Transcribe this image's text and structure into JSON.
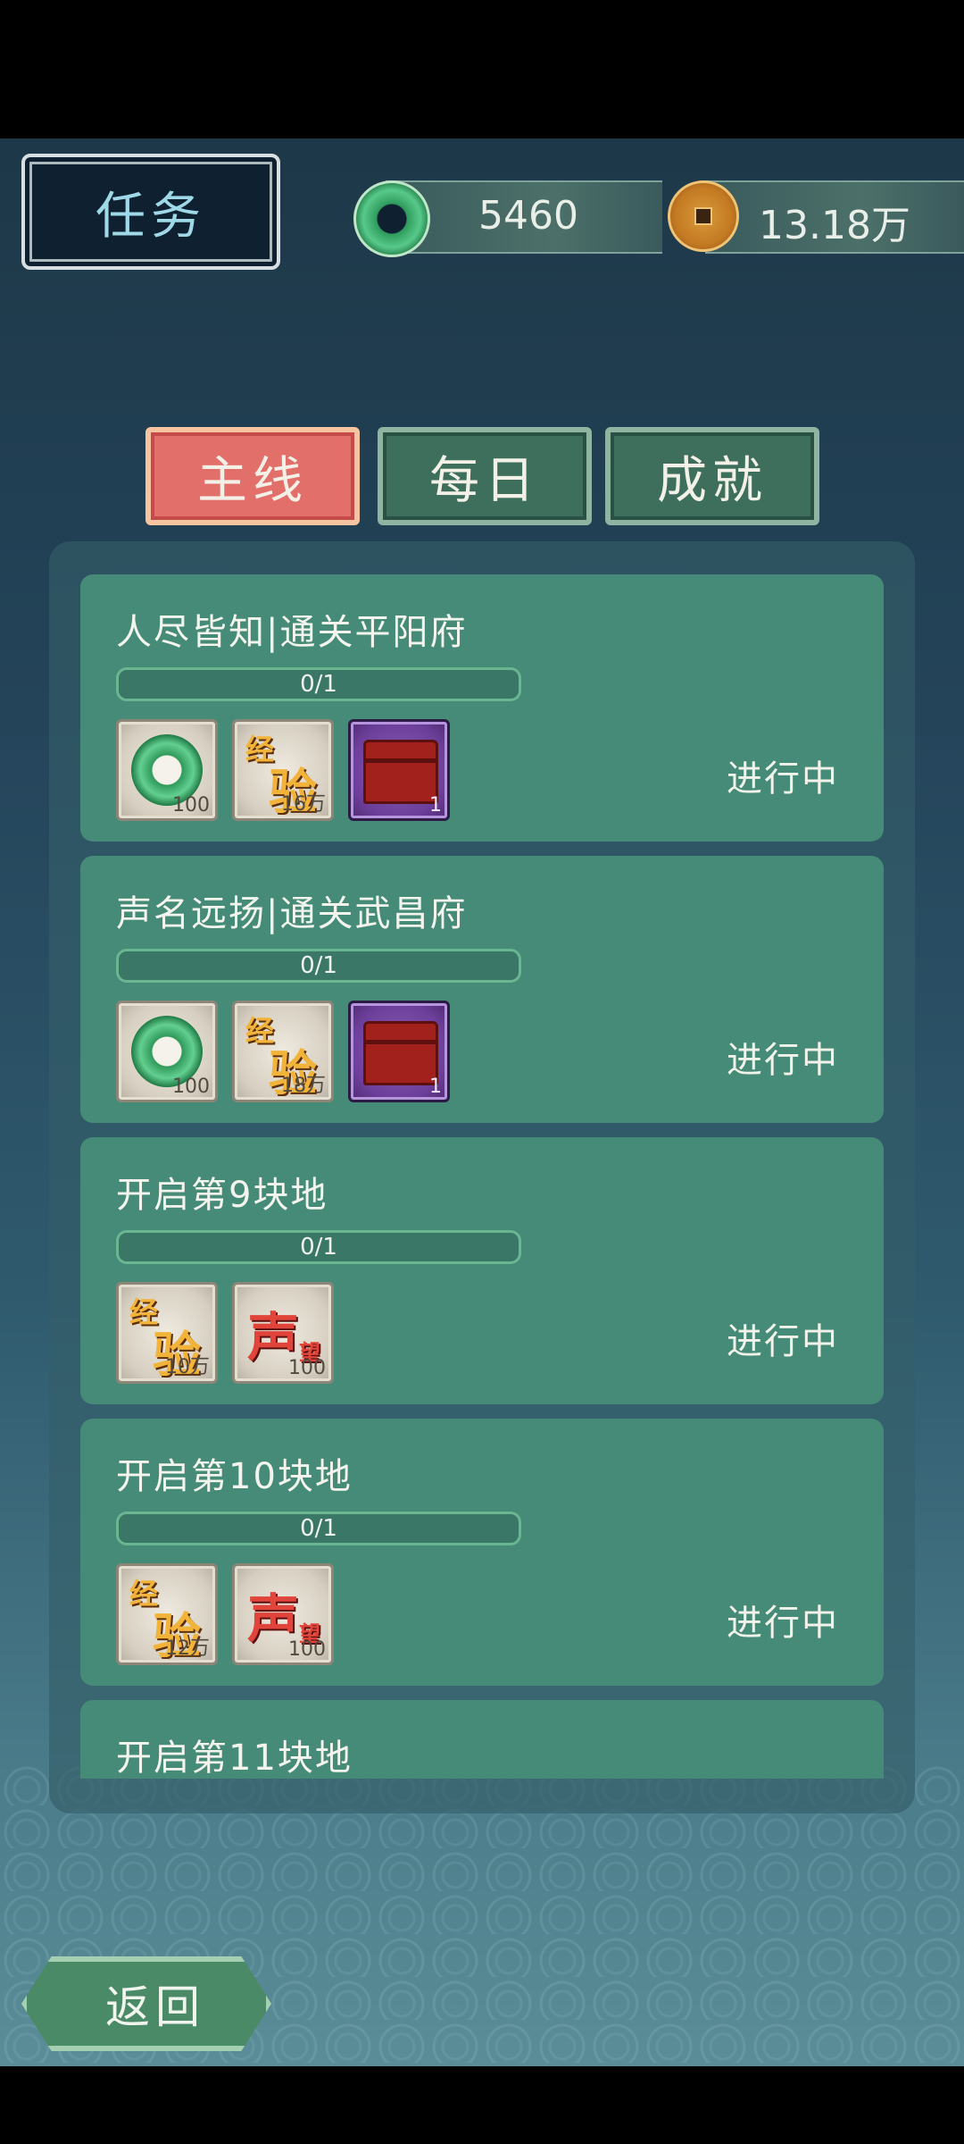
{
  "header": {
    "title": "任务"
  },
  "currency": {
    "jade": "5460",
    "coins": "13.18万"
  },
  "tabs": [
    {
      "label": "主线",
      "active": true
    },
    {
      "label": "每日",
      "active": false
    },
    {
      "label": "成就",
      "active": false
    }
  ],
  "quests": [
    {
      "title": "人尽皆知|通关平阳府",
      "progress": "0/1",
      "status": "进行中",
      "rewards": [
        {
          "icon": "jade-ring-icon",
          "qty": "100"
        },
        {
          "icon": "experience-icon",
          "qty": "16万"
        },
        {
          "icon": "treasure-chest-icon",
          "qty": "1"
        }
      ]
    },
    {
      "title": "声名远扬|通关武昌府",
      "progress": "0/1",
      "status": "进行中",
      "rewards": [
        {
          "icon": "jade-ring-icon",
          "qty": "100"
        },
        {
          "icon": "experience-icon",
          "qty": "18万"
        },
        {
          "icon": "treasure-chest-icon",
          "qty": "1"
        }
      ]
    },
    {
      "title": "开启第9块地",
      "progress": "0/1",
      "status": "进行中",
      "rewards": [
        {
          "icon": "experience-icon",
          "qty": "10万"
        },
        {
          "icon": "fame-icon",
          "qty": "100"
        }
      ]
    },
    {
      "title": "开启第10块地",
      "progress": "0/1",
      "status": "进行中",
      "rewards": [
        {
          "icon": "experience-icon",
          "qty": "12万"
        },
        {
          "icon": "fame-icon",
          "qty": "100"
        }
      ]
    },
    {
      "title": "开启第11块地"
    }
  ],
  "glyphs": {
    "exp_top": "经",
    "exp_bottom": "验",
    "fame_main": "声",
    "fame_sub": "望"
  },
  "footer": {
    "back_label": "返回"
  }
}
